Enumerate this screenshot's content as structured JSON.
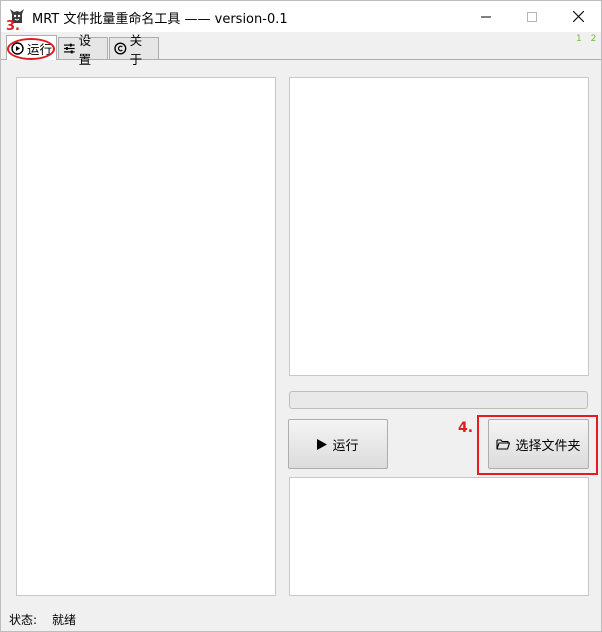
{
  "window": {
    "title": "MRT 文件批量重命名工具 —— version-0.1"
  },
  "tabs": [
    {
      "label": "运行",
      "icon": "play-circle-icon",
      "active": true
    },
    {
      "label": "设置",
      "icon": "sliders-icon",
      "active": false
    },
    {
      "label": "关于",
      "icon": "copyright-icon",
      "active": false
    }
  ],
  "tab_indicator": "1 2",
  "annotations": {
    "step3": "3.",
    "step4": "4."
  },
  "buttons": {
    "run": "运行",
    "select_folder": "选择文件夹"
  },
  "progress": {
    "value": 0
  },
  "status": {
    "label": "状态:",
    "value": "就绪"
  },
  "colors": {
    "annotation_red": "#e31b23",
    "indicator_green": "#6bbf3b"
  }
}
